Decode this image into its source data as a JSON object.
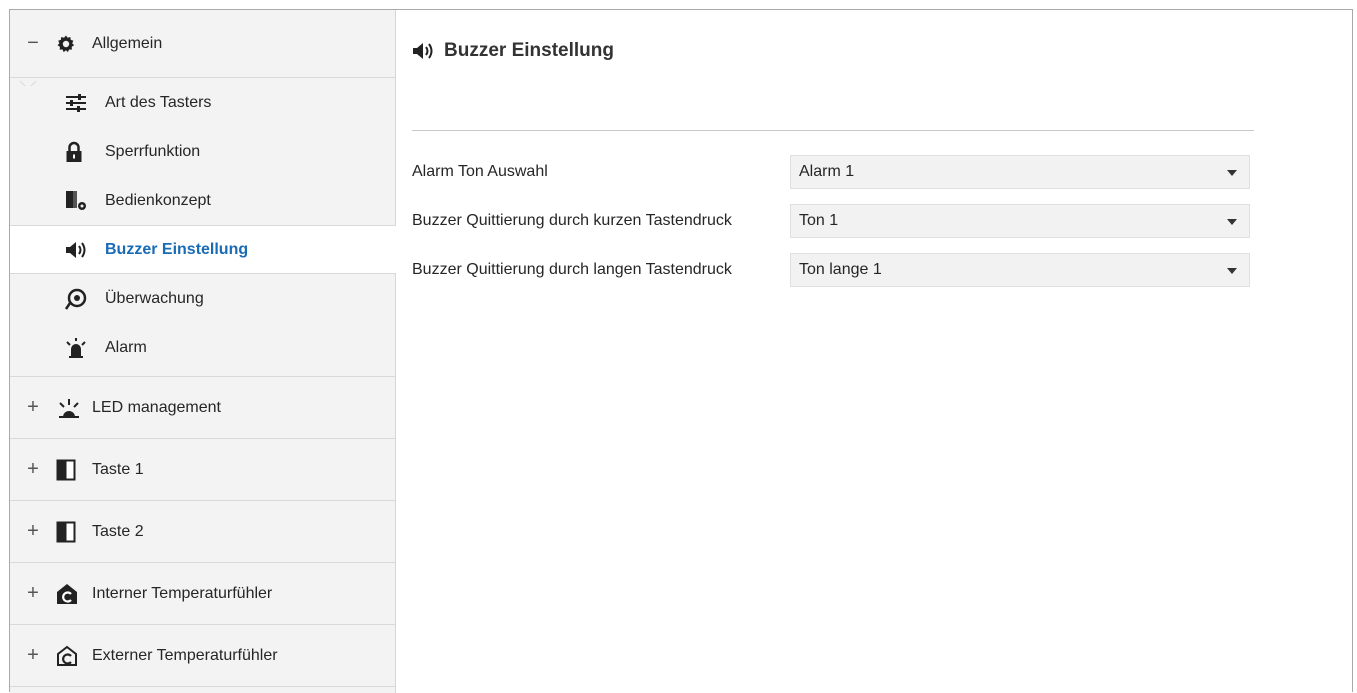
{
  "sidebar": {
    "general": {
      "toggle": "−",
      "label": "Allgemein",
      "icon": "gear-icon"
    },
    "sub_items": [
      {
        "label": "Art des Tasters",
        "icon": "sliders-icon"
      },
      {
        "label": "Sperrfunktion",
        "icon": "lock-icon"
      },
      {
        "label": "Bedienkonzept",
        "icon": "operating-concept-icon"
      },
      {
        "label": "Buzzer Einstellung",
        "icon": "speaker-icon",
        "active": true
      },
      {
        "label": "Überwachung",
        "icon": "monitoring-eye-icon"
      },
      {
        "label": "Alarm",
        "icon": "alarm-light-icon"
      }
    ],
    "groups": [
      {
        "toggle": "+",
        "label": "LED management",
        "icon": "led-icon"
      },
      {
        "toggle": "+",
        "label": "Taste 1",
        "icon": "button-half-icon"
      },
      {
        "toggle": "+",
        "label": "Taste 2",
        "icon": "button-half-icon"
      },
      {
        "toggle": "+",
        "label": "Interner Temperaturfühler",
        "icon": "internal-temp-sensor-icon"
      },
      {
        "toggle": "+",
        "label": "Externer Temperaturfühler",
        "icon": "external-temp-sensor-icon"
      }
    ]
  },
  "main": {
    "title": "Buzzer Einstellung",
    "title_icon": "speaker-icon",
    "settings": [
      {
        "label": "Alarm Ton Auswahl",
        "value": "Alarm 1"
      },
      {
        "label": "Buzzer Quittierung durch kurzen Tastendruck",
        "value": "Ton 1"
      },
      {
        "label": "Buzzer Quittierung durch langen Tastendruck",
        "value": "Ton lange 1"
      }
    ]
  },
  "colors": {
    "active_text": "#1a6bb5",
    "sidebar_bg": "#f3f3f3",
    "select_bg": "#f2f2f2"
  }
}
